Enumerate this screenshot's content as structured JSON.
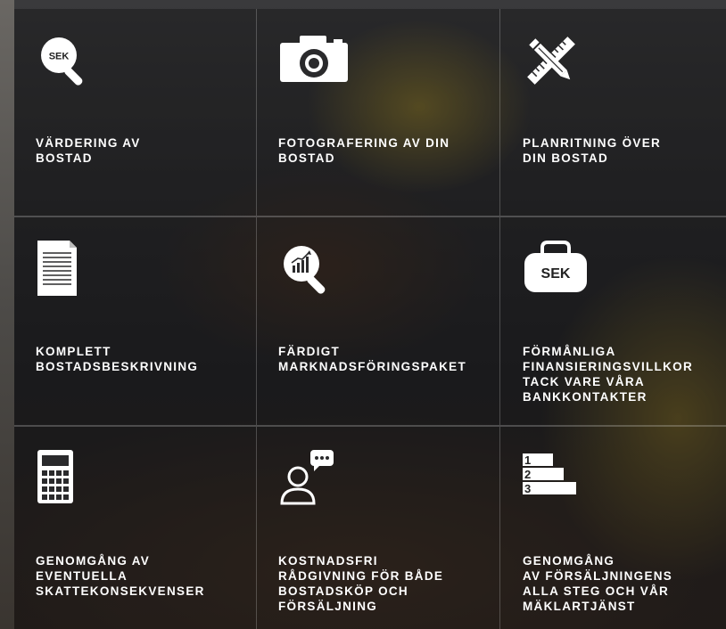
{
  "icons": {
    "sek_magnifier_text": "SEK",
    "sek_bag_text": "SEK",
    "ranking_numbers": [
      "1",
      "2",
      "3"
    ]
  },
  "services": [
    {
      "icon": "sek-magnifier-icon",
      "label": "VÄRDERING AV\nBOSTAD"
    },
    {
      "icon": "camera-icon",
      "label": "FOTOGRAFERING AV DIN\nBOSTAD"
    },
    {
      "icon": "pencil-ruler-icon",
      "label": "PLANRITNING ÖVER\nDIN BOSTAD"
    },
    {
      "icon": "document-icon",
      "label": "KOMPLETT\nBOSTADSBESKRIVNING"
    },
    {
      "icon": "chart-magnifier-icon",
      "label": "FÄRDIGT\nMARKNADSFÖRINGSPAKET"
    },
    {
      "icon": "sek-bag-icon",
      "label": "FÖRMÅNLIGA\nFINANSIERINGSVILLKOR\nTACK VARE VÅRA\nBANKKONTAKTER"
    },
    {
      "icon": "calculator-icon",
      "label": "GENOMGÅNG AV\nEVENTUELLA\nSKATTEKONSEKVENSER"
    },
    {
      "icon": "advisor-chat-icon",
      "label": "KOSTNADSFRI\nRÅDGIVNING FÖR BÅDE\nBOSTADSKÖP OCH\nFÖRSÄLJNING"
    },
    {
      "icon": "ranking-steps-icon",
      "label": "GENOMGÅNG\nAV FÖRSÄLJNINGENS\nALLA STEG OCH VÅR\nMÄKLARTJÄNST"
    }
  ]
}
